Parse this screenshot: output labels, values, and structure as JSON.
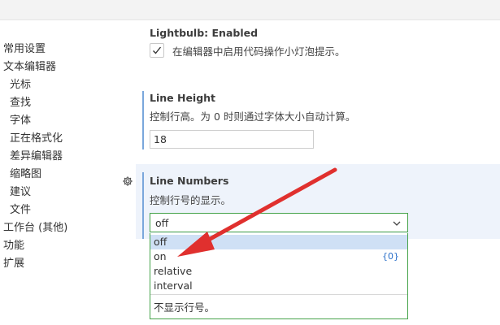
{
  "sidebar": {
    "items": [
      {
        "label": "常用设置",
        "sub": false
      },
      {
        "label": "文本编辑器",
        "sub": false
      },
      {
        "label": "光标",
        "sub": true
      },
      {
        "label": "查找",
        "sub": true
      },
      {
        "label": "字体",
        "sub": true
      },
      {
        "label": "正在格式化",
        "sub": true
      },
      {
        "label": "差异编辑器",
        "sub": true
      },
      {
        "label": "缩略图",
        "sub": true
      },
      {
        "label": "建议",
        "sub": true
      },
      {
        "label": "文件",
        "sub": true
      },
      {
        "label": "工作台 (其他)",
        "sub": false
      },
      {
        "label": "功能",
        "sub": false
      },
      {
        "label": "扩展",
        "sub": false
      }
    ]
  },
  "lightbulb": {
    "title": "Lightbulb: Enabled",
    "description": "在编辑器中启用代码操作小灯泡提示。",
    "checked": true
  },
  "line_height": {
    "title": "Line Height",
    "description": "控制行高。为 0 时则通过字体大小自动计算。",
    "value": "18"
  },
  "line_numbers": {
    "title": "Line Numbers",
    "description": "控制行号的显示。",
    "selected": "off",
    "options": [
      {
        "label": "off",
        "badge": ""
      },
      {
        "label": "on",
        "badge": "{0}"
      },
      {
        "label": "relative",
        "badge": ""
      },
      {
        "label": "interval",
        "badge": ""
      }
    ],
    "option_description": "不显示行号。"
  },
  "icons": {
    "gear": "gear-icon",
    "check": "checkmark-icon",
    "chevron": "chevron-down-icon",
    "arrow": "red-annotation-arrow"
  },
  "colors": {
    "accent_border": "#46a34a",
    "selected_option_bg": "#cfe0f5",
    "focus_bar": "#7aa7dc",
    "annotation_arrow": "#e0302e",
    "badge": "#2a6fc9"
  }
}
